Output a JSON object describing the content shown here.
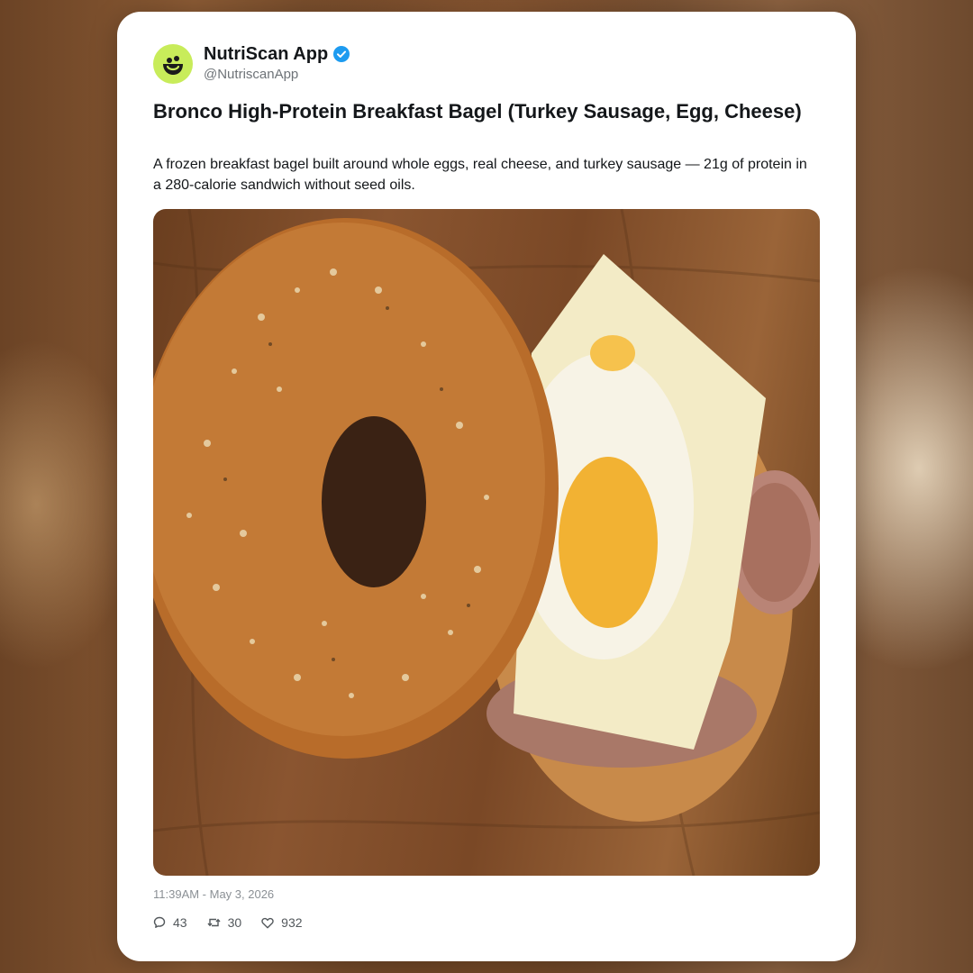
{
  "post": {
    "author": {
      "display_name": "NutriScan App",
      "handle": "@NutriscanApp",
      "verified": true,
      "avatar_icon": "smiley-leaf-logo",
      "avatar_color": "#c8ec5a",
      "verified_color": "#1d9bf0"
    },
    "title": "Bronco High-Protein Breakfast Bagel (Turkey Sausage, Egg, Cheese)",
    "description": "A frozen breakfast bagel built around whole eggs, real cheese, and turkey sausage — 21g of protein in a 280-calorie sandwich without seed oils.",
    "image": {
      "subject": "breakfast bagel sandwich with egg, cheese and turkey sausage on wooden board"
    },
    "timestamp": "11:39AM - May 3, 2026",
    "stats": {
      "replies": "43",
      "reposts": "30",
      "likes": "932"
    }
  }
}
